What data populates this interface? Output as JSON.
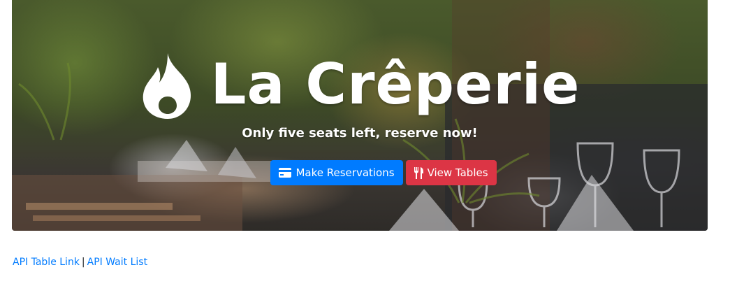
{
  "hero": {
    "title": "La Crêperie",
    "tagline": "Only five seats left, reserve now!",
    "icon": "flame-icon",
    "background_image": "restaurant-patio-photo"
  },
  "buttons": {
    "reserve": {
      "label": "Make Reservations",
      "icon": "credit-card-icon",
      "color": "#007bff"
    },
    "tables": {
      "label": "View Tables",
      "icon": "utensils-icon",
      "color": "#dc3545"
    }
  },
  "footer_links": {
    "api_tables": "API Table Link",
    "separator": "|",
    "api_waitlist": "API Wait List",
    "link_color": "#007bff"
  }
}
